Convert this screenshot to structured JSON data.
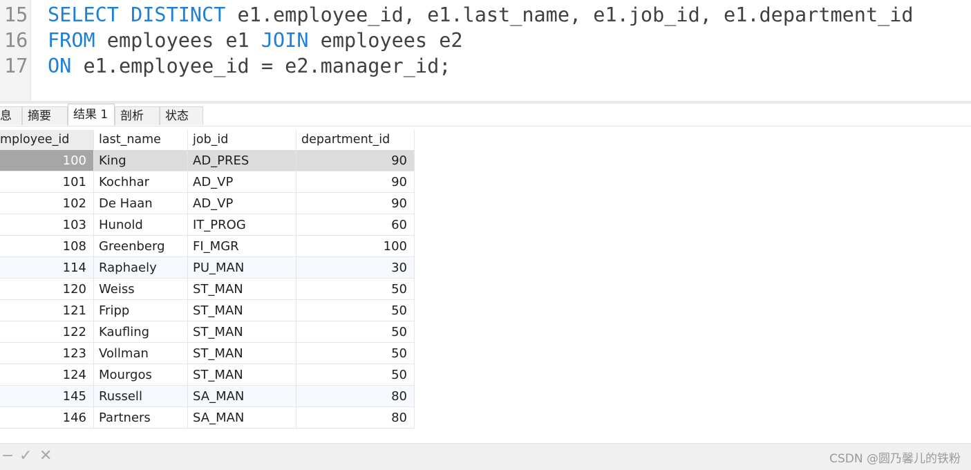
{
  "editor": {
    "lines": [
      {
        "num": "15",
        "parts": [
          {
            "t": "SELECT DISTINCT",
            "kw": true
          },
          {
            "t": " e1.employee_id, e1.last_name, e1.job_id, e1.department_id",
            "kw": false
          }
        ]
      },
      {
        "num": "16",
        "parts": [
          {
            "t": "FROM",
            "kw": true
          },
          {
            "t": " employees e1 ",
            "kw": false
          },
          {
            "t": "JOIN",
            "kw": true
          },
          {
            "t": " employees e2",
            "kw": false
          }
        ]
      },
      {
        "num": "17",
        "parts": [
          {
            "t": "ON",
            "kw": true
          },
          {
            "t": " e1.employee_id = e2.manager_id;",
            "kw": false
          }
        ]
      }
    ]
  },
  "tabs": {
    "info": "息",
    "summary": "摘要",
    "result": "结果 1",
    "profile": "剖析",
    "status": "状态"
  },
  "grid": {
    "columns": [
      "mployee_id",
      "last_name",
      "job_id",
      "department_id"
    ],
    "rows": [
      [
        "100",
        "King",
        "AD_PRES",
        "90"
      ],
      [
        "101",
        "Kochhar",
        "AD_VP",
        "90"
      ],
      [
        "102",
        "De Haan",
        "AD_VP",
        "90"
      ],
      [
        "103",
        "Hunold",
        "IT_PROG",
        "60"
      ],
      [
        "108",
        "Greenberg",
        "FI_MGR",
        "100"
      ],
      [
        "114",
        "Raphaely",
        "PU_MAN",
        "30"
      ],
      [
        "120",
        "Weiss",
        "ST_MAN",
        "50"
      ],
      [
        "121",
        "Fripp",
        "ST_MAN",
        "50"
      ],
      [
        "122",
        "Kaufling",
        "ST_MAN",
        "50"
      ],
      [
        "123",
        "Vollman",
        "ST_MAN",
        "50"
      ],
      [
        "124",
        "Mourgos",
        "ST_MAN",
        "50"
      ],
      [
        "145",
        "Russell",
        "SA_MAN",
        "80"
      ],
      [
        "146",
        "Partners",
        "SA_MAN",
        "80"
      ]
    ],
    "selected_row": 0,
    "alt_rows": [
      5,
      11
    ]
  },
  "statusbar": {
    "icons": {
      "minus": "−",
      "check": "✓",
      "cross": "✕"
    },
    "watermark": "CSDN @圆乃馨儿的铁粉"
  },
  "colors": {
    "keyword": "#1e7fd8",
    "selected_row": "#dcdcdc",
    "selected_cell": "#a6a6a6"
  }
}
